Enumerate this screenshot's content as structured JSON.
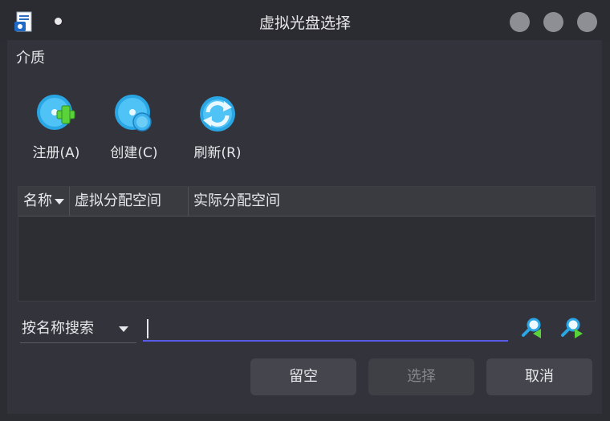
{
  "window": {
    "title": "虚拟光盘选择",
    "controls": [
      "minimize-icon",
      "maximize-icon",
      "close-icon"
    ]
  },
  "media_group": {
    "label": "介质",
    "tools": [
      {
        "label": "注册(A)",
        "icon": "add-icon"
      },
      {
        "label": "创建(C)",
        "icon": "disc-create-icon"
      },
      {
        "label": "刷新(R)",
        "icon": "refresh-icon"
      }
    ]
  },
  "table": {
    "columns": [
      "名称",
      "虚拟分配空间",
      "实际分配空间"
    ],
    "rows": []
  },
  "search": {
    "mode": "按名称搜索",
    "value": ""
  },
  "buttons": {
    "leave_empty": "留空",
    "choose": "选择",
    "cancel": "取消"
  },
  "colors": {
    "accent": "#5a5ae8",
    "icon_blue": "#2aa6e5",
    "icon_green": "#5ad23a"
  }
}
